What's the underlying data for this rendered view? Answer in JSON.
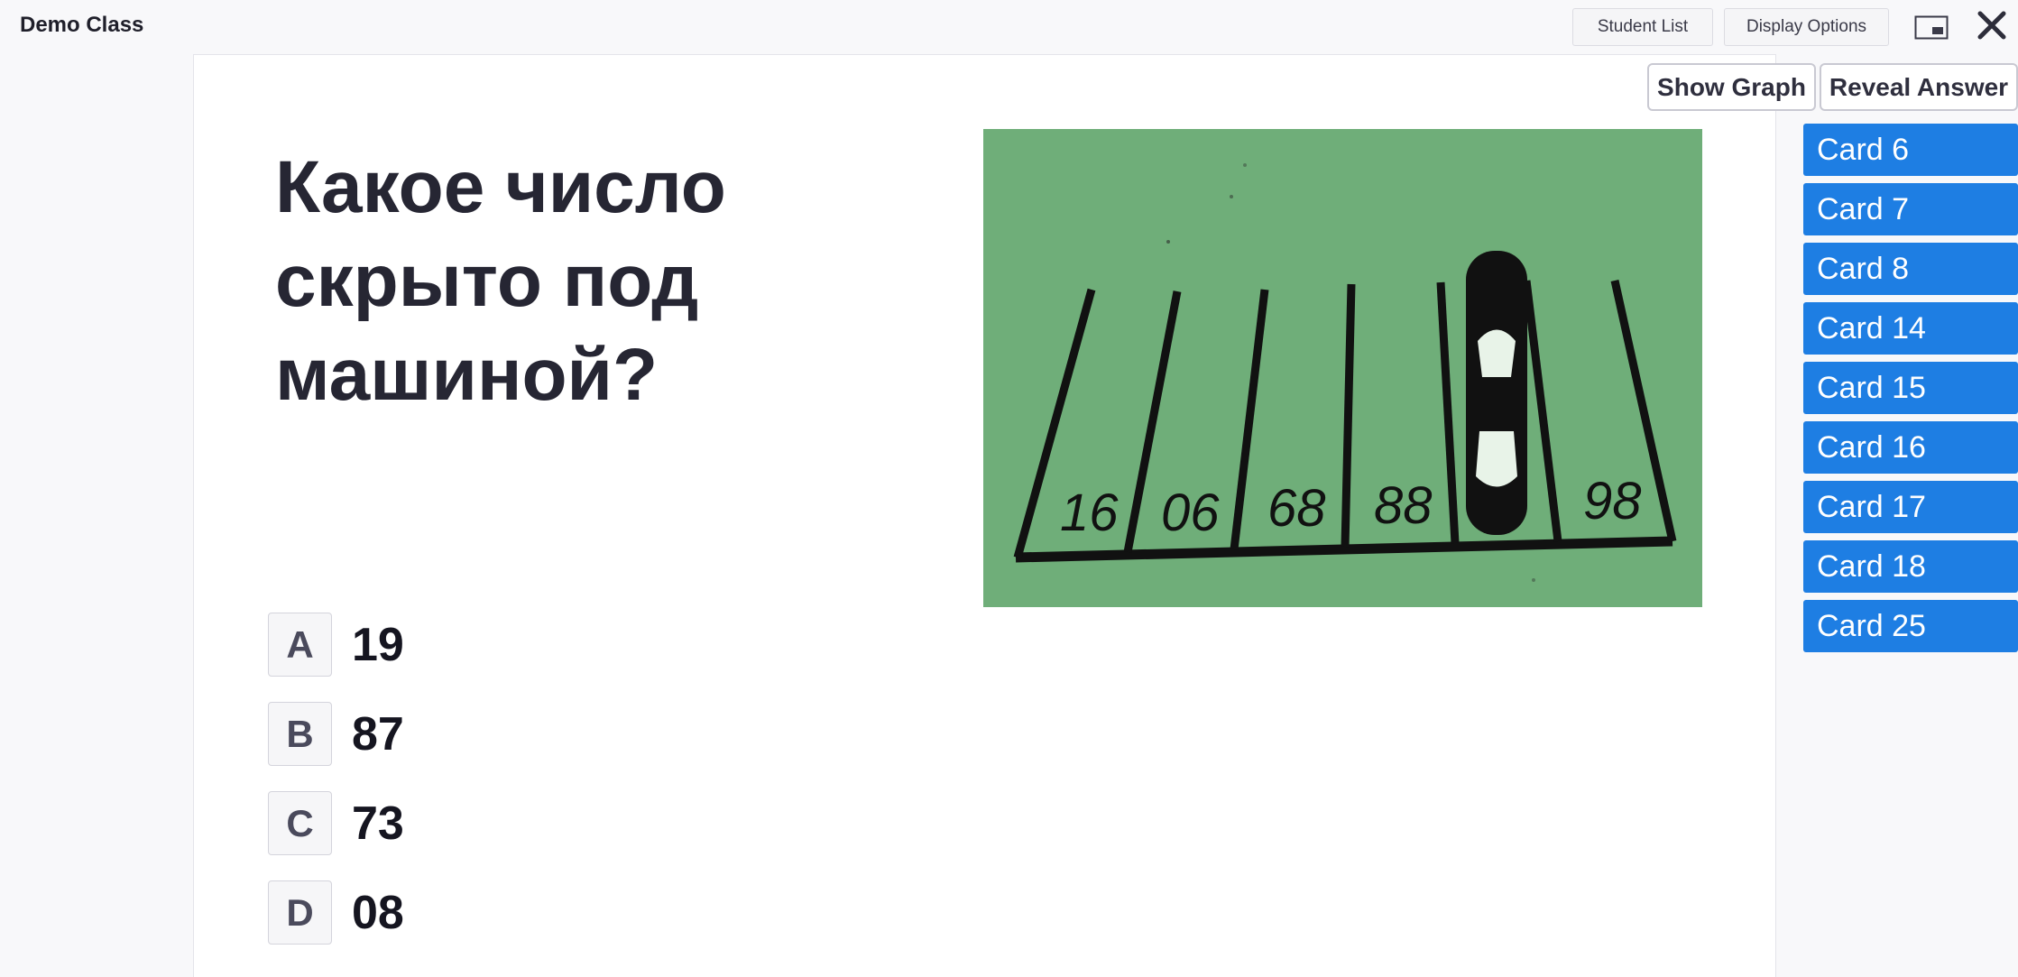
{
  "header": {
    "class_name": "Demo Class",
    "student_list_label": "Student List",
    "display_options_label": "Display Options"
  },
  "question": {
    "text": "Какое число скрыто под машиной?",
    "image": {
      "visible_numbers": [
        "16",
        "06",
        "68",
        "88",
        "98"
      ]
    },
    "answers": [
      {
        "letter": "A",
        "value": "19"
      },
      {
        "letter": "B",
        "value": "87"
      },
      {
        "letter": "C",
        "value": "73"
      },
      {
        "letter": "D",
        "value": "08"
      }
    ]
  },
  "controls": {
    "show_graph_label": "Show Graph",
    "reveal_answer_label": "Reveal Answer"
  },
  "cards": [
    "Card 6",
    "Card 7",
    "Card 8",
    "Card 14",
    "Card 15",
    "Card 16",
    "Card 17",
    "Card 18",
    "Card 25"
  ],
  "colors": {
    "card_blue": "#1e7ee3",
    "image_green": "#6fae79"
  },
  "icons": [
    "picture-in-picture-icon",
    "close-icon"
  ]
}
